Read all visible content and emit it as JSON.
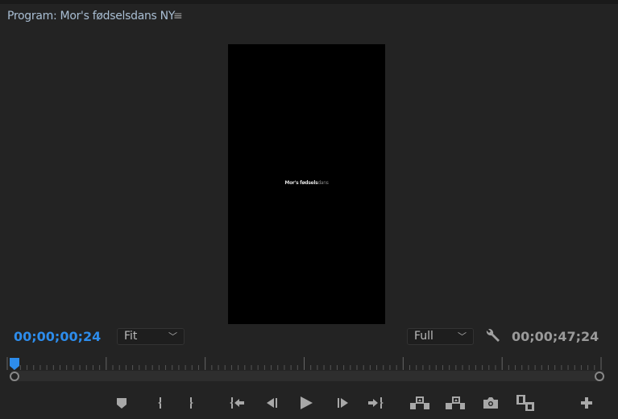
{
  "panel": {
    "title": "Program: Mor's fødselsdans NY",
    "menu_icon": "hamburger-icon"
  },
  "video": {
    "text_bold": "Mor's fødsels",
    "text_light": "dans"
  },
  "timecode": {
    "current": "00;00;00;24",
    "duration": "00;00;47;24"
  },
  "zoom_select": {
    "value": "Fit"
  },
  "resolution_select": {
    "value": "Full"
  },
  "playhead": {
    "fraction": 0.003
  },
  "colors": {
    "accent": "#2d8ceb",
    "title": "#a9bed3",
    "background": "#232323"
  },
  "controls": [
    "add-marker",
    "mark-in",
    "mark-out",
    "go-to-in",
    "step-back",
    "play",
    "step-forward",
    "go-to-out",
    "lift",
    "extract",
    "export-frame",
    "compare-view",
    "button-editor"
  ]
}
